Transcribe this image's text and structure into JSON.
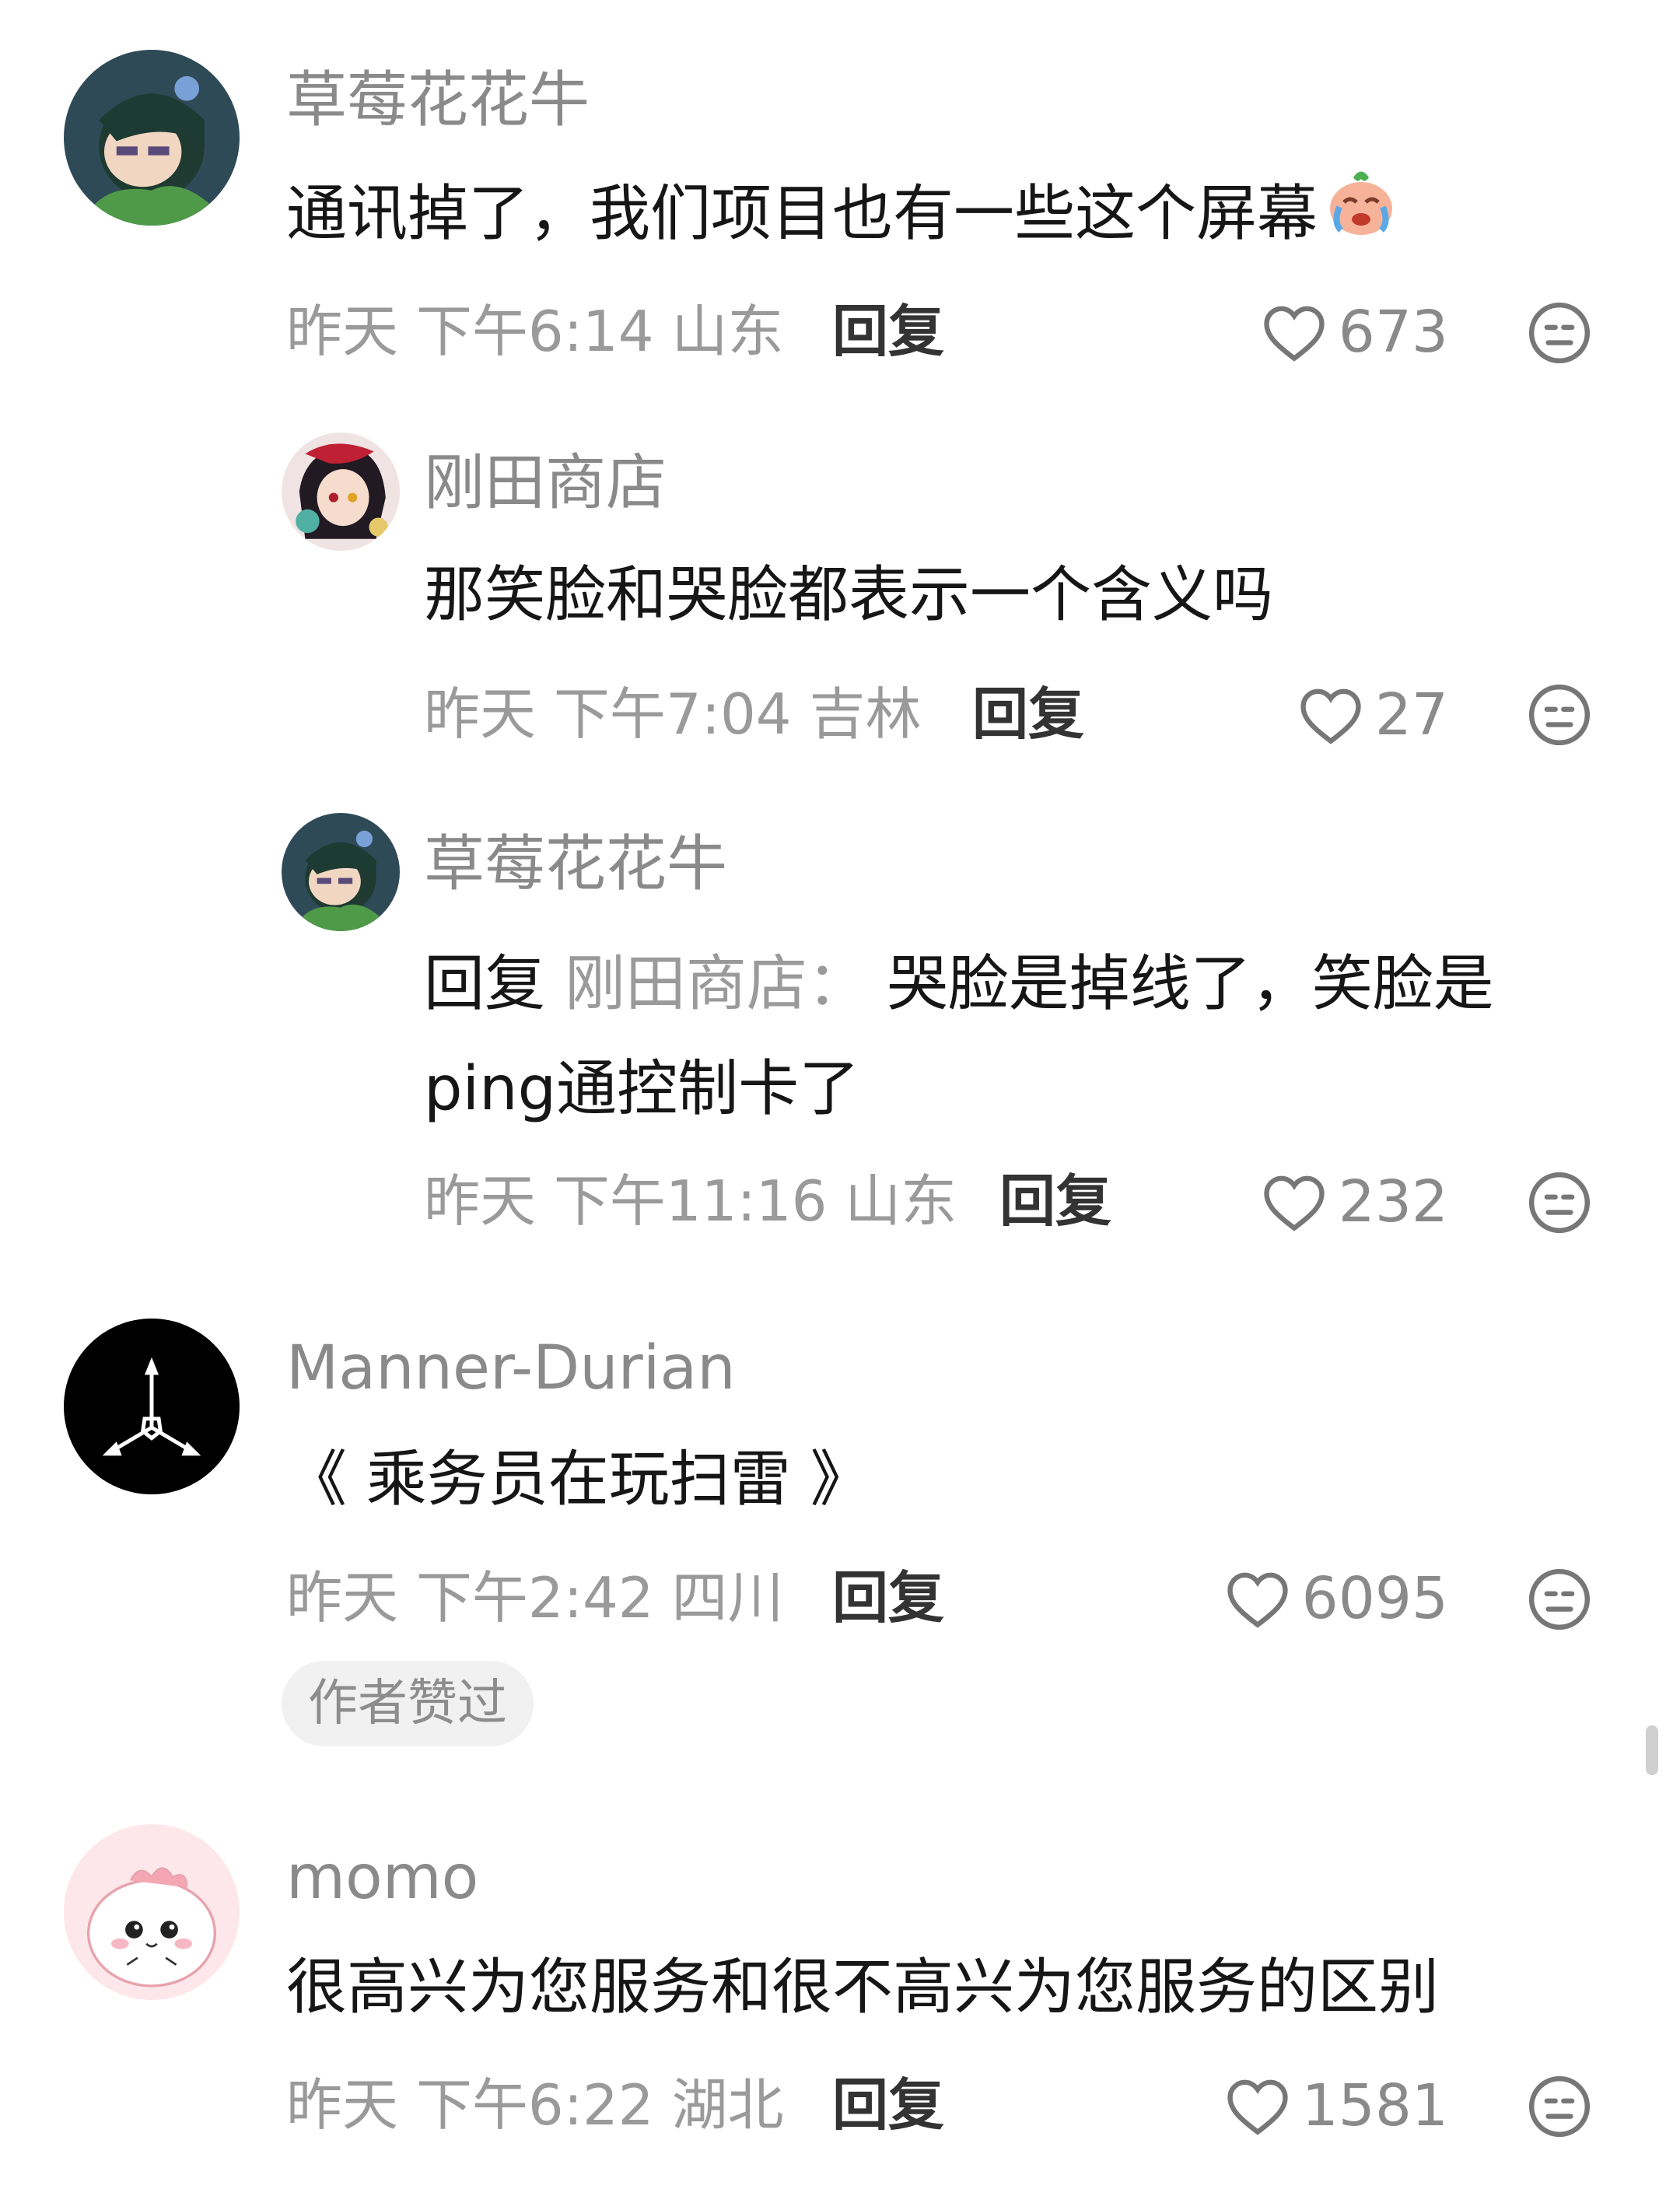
{
  "comments": [
    {
      "user": "草莓花花牛",
      "text": "通讯掉了，我们项目也有一些这个屏幕",
      "emoji": "crying-face-emoji",
      "meta": "昨天 下午6:14 山东",
      "reply": "回复",
      "likes": "673"
    },
    {
      "user": "刚田商店",
      "text": "那笑脸和哭脸都表示一个含义吗",
      "meta": "昨天 下午7:04 吉林",
      "reply": "回复",
      "likes": "27"
    },
    {
      "user": "草莓花花牛",
      "reply_prefix": "回复",
      "reply_to": "刚田商店：",
      "text_line1": "哭脸是掉线了，笑脸是",
      "text_line2": "ping通控制卡了",
      "meta": "昨天 下午11:16 山东",
      "reply": "回复",
      "likes": "232"
    },
    {
      "user": "Manner-Durian",
      "text": "《 乘务员在玩扫雷 》",
      "meta": "昨天 下午2:42 四川",
      "reply": "回复",
      "likes": "6095",
      "badge": "作者赞过"
    },
    {
      "user": "momo",
      "text": "很高兴为您服务和很不高兴为您服务的区别",
      "meta": "昨天 下午6:22 湖北",
      "reply": "回复",
      "likes": "1581"
    }
  ],
  "icons": {
    "like": "heart-outline-icon",
    "dislike": "neutral-face-icon"
  },
  "colors": {
    "username": "#8a8a8a",
    "meta": "#9a9a9a",
    "text": "#161616",
    "badge_bg": "#f1f1f1"
  }
}
